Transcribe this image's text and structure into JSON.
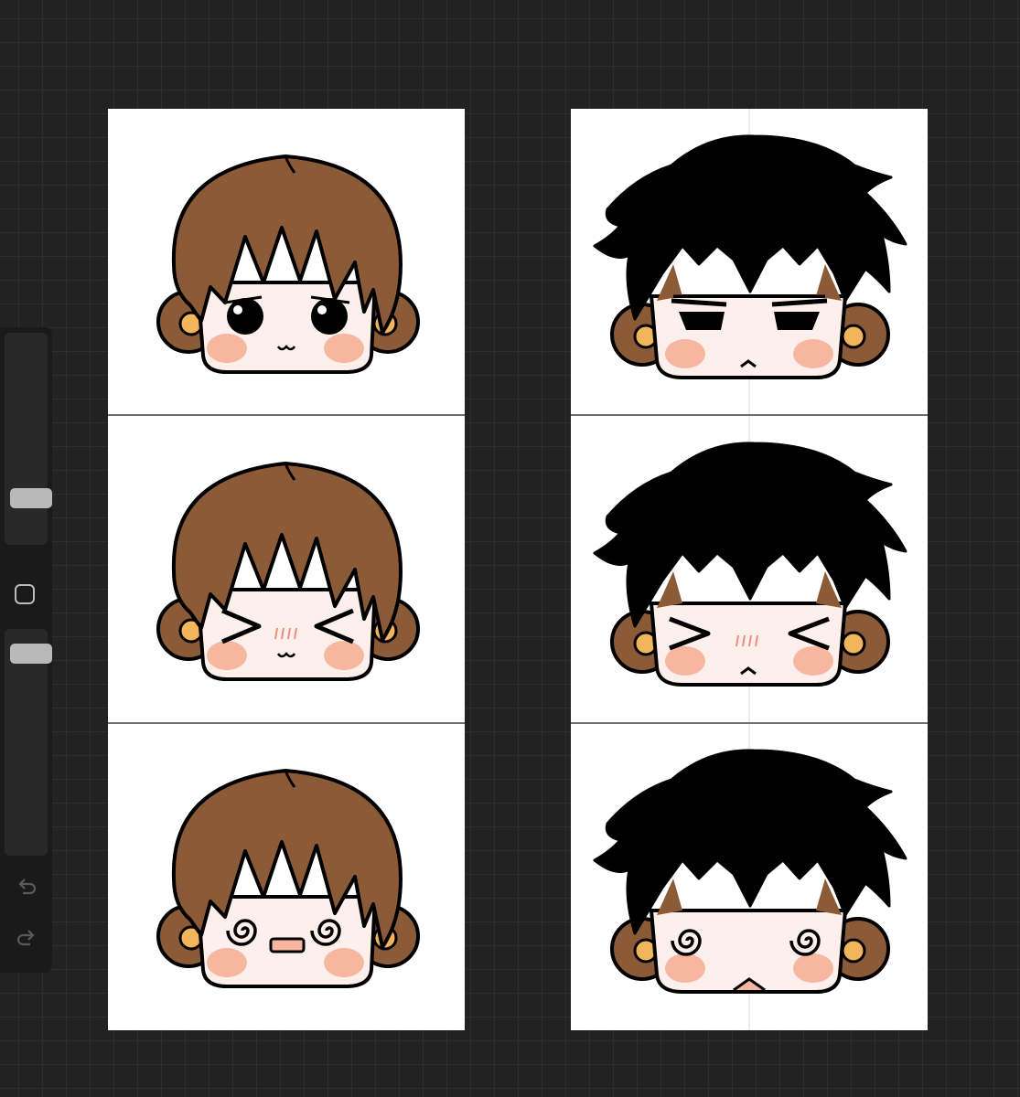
{
  "toolbar": {
    "tools": [
      "brush-size-slider",
      "modify-button",
      "opacity-slider",
      "undo-button",
      "redo-button"
    ]
  },
  "canvases": [
    {
      "character": "brown-hair",
      "hair_color": "#8b5a36",
      "panels": [
        {
          "expression": "neutral-round-eyes",
          "mouth": "cat"
        },
        {
          "expression": "squint-blush",
          "mouth": "cat"
        },
        {
          "expression": "dizzy-spiral-eyes",
          "mouth": "open"
        }
      ]
    },
    {
      "character": "black-hair",
      "hair_color": "#000000",
      "panels": [
        {
          "expression": "half-lidded-eyes",
          "mouth": "frown"
        },
        {
          "expression": "squint-blush",
          "mouth": "frown"
        },
        {
          "expression": "dizzy-spiral-eyes",
          "mouth": "triangle"
        }
      ]
    }
  ],
  "colors": {
    "skin": "#fdf0ec",
    "cheek": "#f7b6a0",
    "ear": "#8b5a36",
    "inner_ear": "#f2b65a",
    "outline": "#000000"
  }
}
